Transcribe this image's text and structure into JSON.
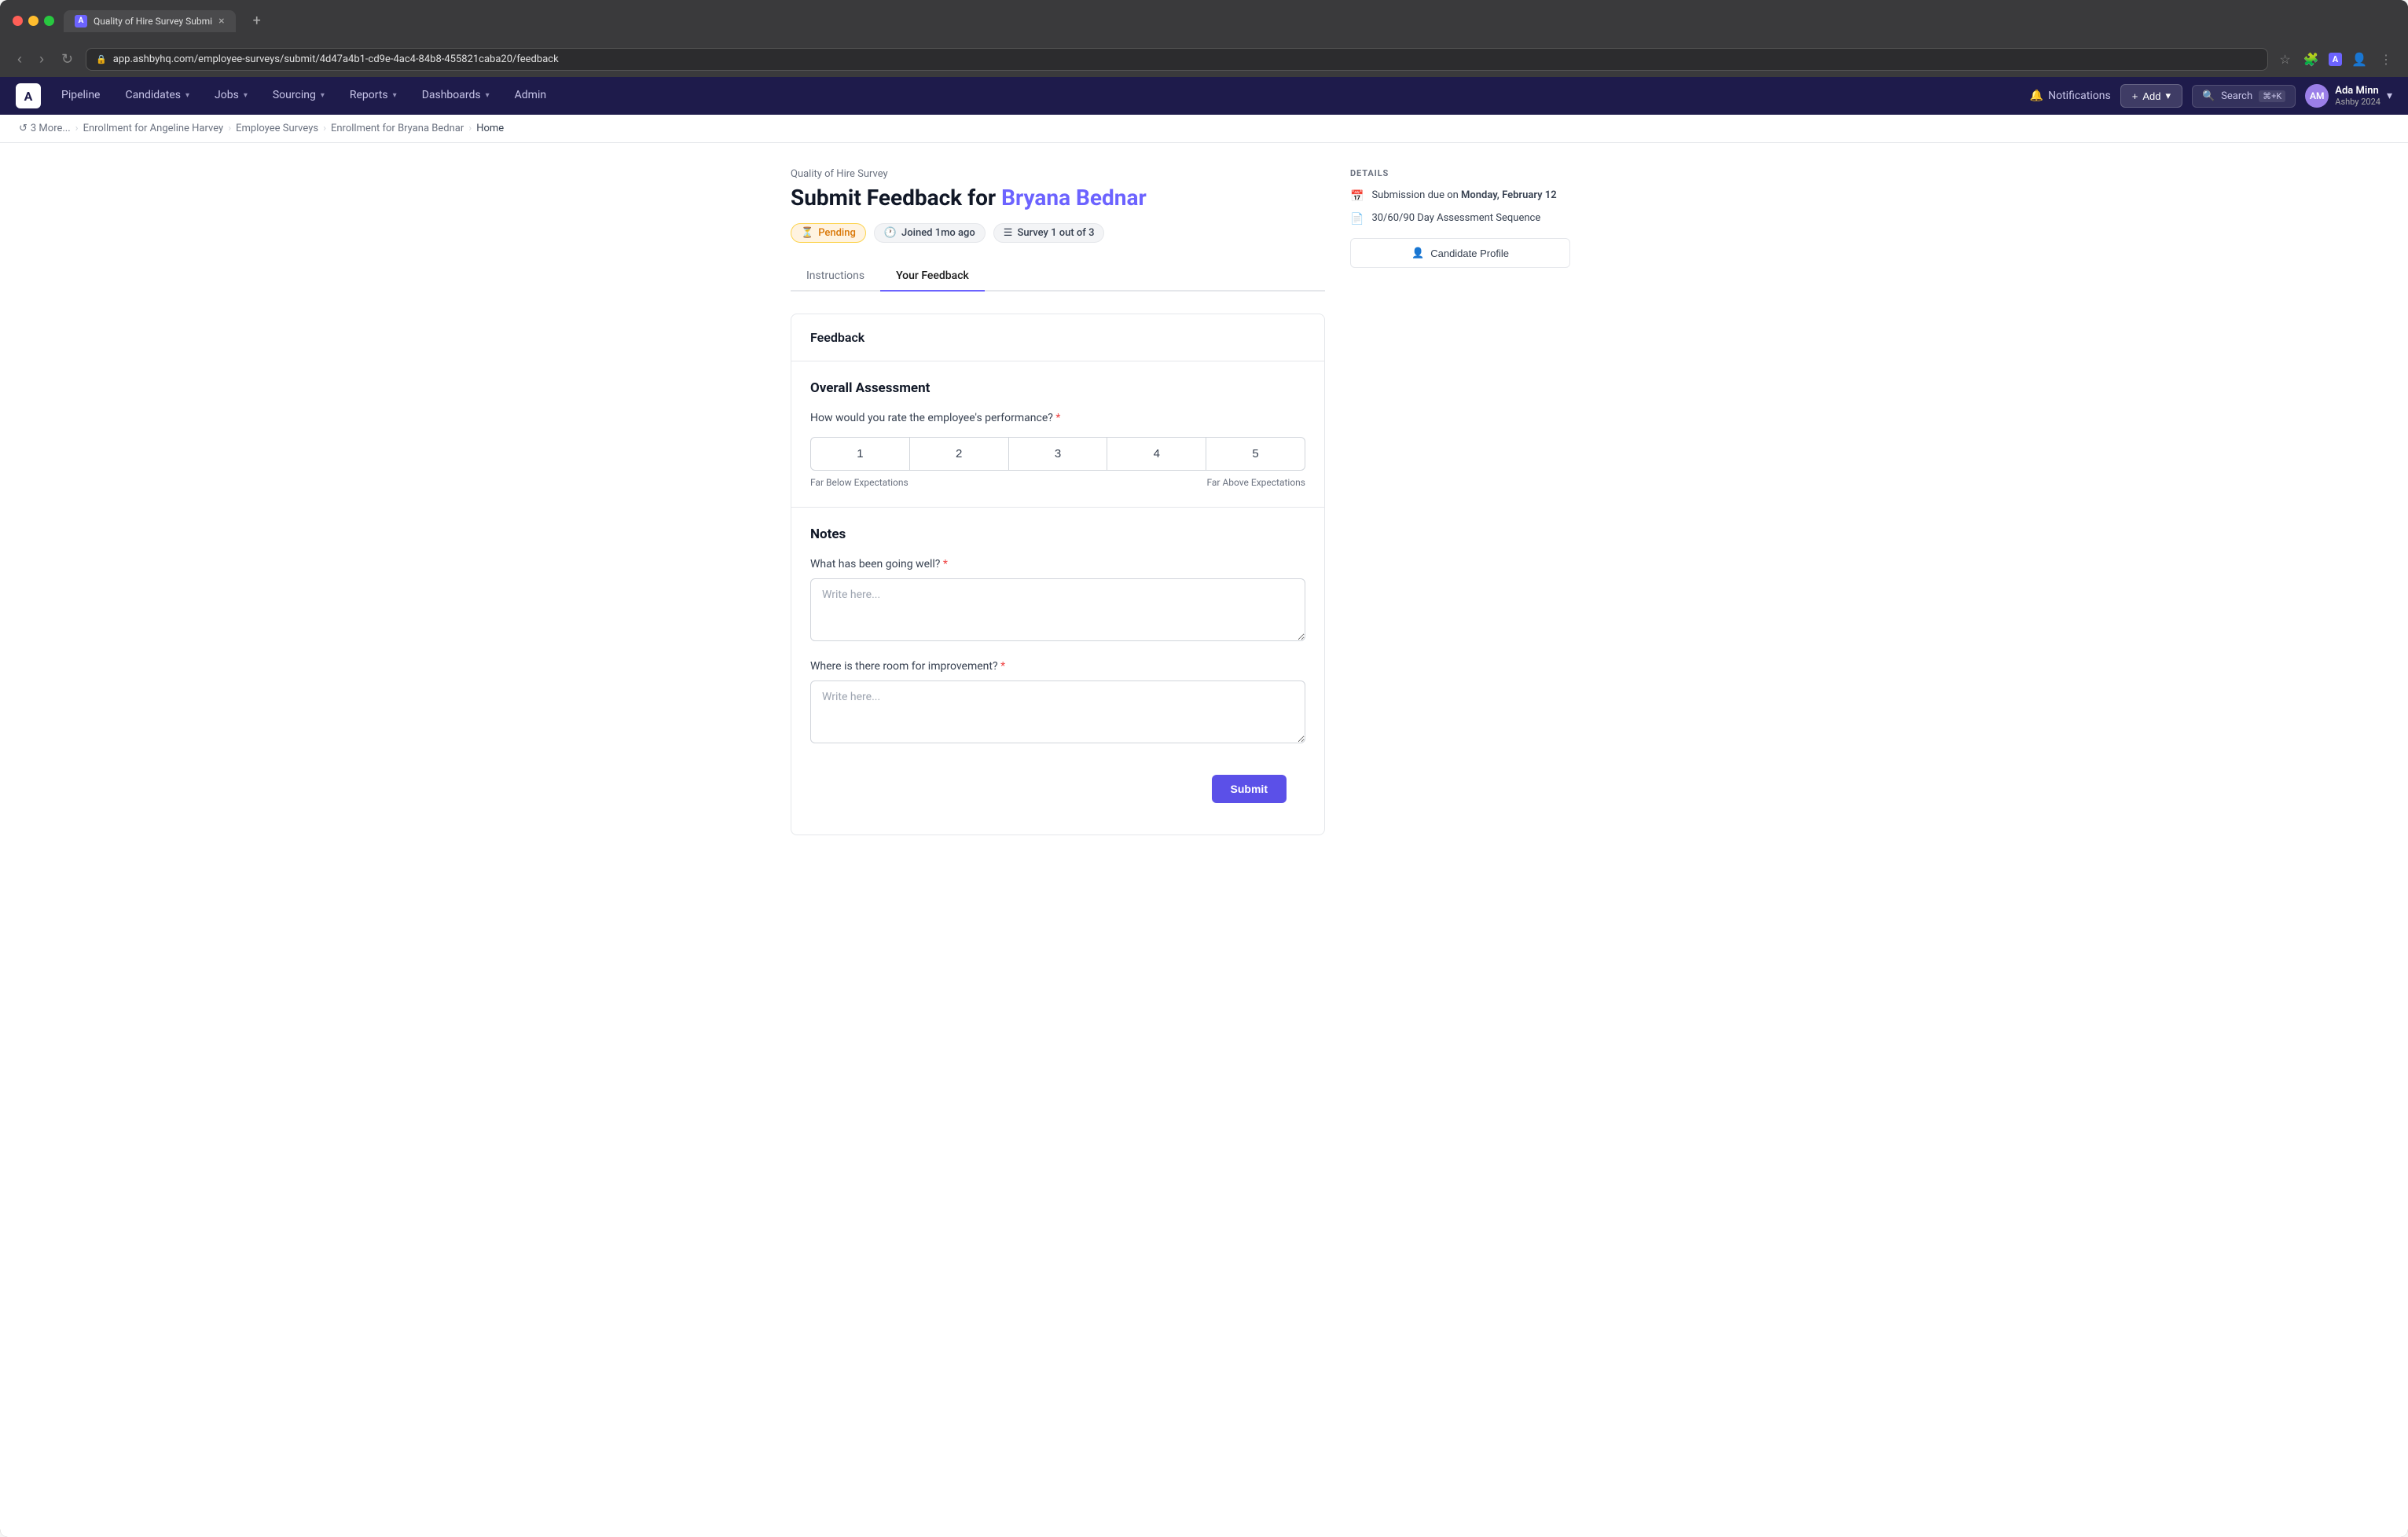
{
  "browser": {
    "tab_title": "Quality of Hire Survey Submi",
    "tab_favicon": "A",
    "url": "app.ashbyhq.com/employee-surveys/submit/4d47a4b1-cd9e-4ac4-84b8-455821caba20/feedback",
    "new_tab_icon": "+"
  },
  "nav": {
    "logo": "A",
    "items": [
      {
        "label": "Pipeline",
        "has_dropdown": false
      },
      {
        "label": "Candidates",
        "has_dropdown": true
      },
      {
        "label": "Jobs",
        "has_dropdown": true
      },
      {
        "label": "Sourcing",
        "has_dropdown": true
      },
      {
        "label": "Reports",
        "has_dropdown": true
      },
      {
        "label": "Dashboards",
        "has_dropdown": true
      },
      {
        "label": "Admin",
        "has_dropdown": false
      }
    ],
    "notifications_label": "Notifications",
    "add_label": "Add",
    "search_label": "Search",
    "search_kbd": "⌘+K",
    "user_name": "Ada Minn",
    "user_org": "Ashby 2024",
    "user_initials": "AM"
  },
  "breadcrumb": {
    "items": [
      {
        "label": "3 More...",
        "active": false
      },
      {
        "label": "Enrollment for Angeline Harvey",
        "active": false
      },
      {
        "label": "Employee Surveys",
        "active": false
      },
      {
        "label": "Enrollment for Bryana Bednar",
        "active": false
      },
      {
        "label": "Home",
        "active": true
      }
    ]
  },
  "page": {
    "survey_label": "Quality of Hire Survey",
    "title_prefix": "Submit Feedback for",
    "candidate_name": "Bryana Bednar",
    "status": {
      "pending_label": "Pending",
      "joined_label": "Joined 1mo ago",
      "survey_label": "Survey 1 out of 3"
    },
    "tabs": [
      {
        "label": "Instructions",
        "active": false
      },
      {
        "label": "Your Feedback",
        "active": true
      }
    ],
    "feedback_section": {
      "header": "Feedback",
      "overall_assessment": {
        "title": "Overall Assessment",
        "question": "How would you rate the employee's performance?",
        "required": true,
        "rating_options": [
          "1",
          "2",
          "3",
          "4",
          "5"
        ],
        "label_low": "Far Below Expectations",
        "label_high": "Far Above Expectations"
      },
      "notes": {
        "title": "Notes",
        "question1": "What has been going well?",
        "question1_required": true,
        "placeholder1": "Write here...",
        "question2": "Where is there room for improvement?",
        "question2_required": true,
        "placeholder2": "Write here..."
      },
      "submit_label": "Submit"
    },
    "details": {
      "section_label": "DETAILS",
      "submission_label": "Submission due on",
      "submission_date": "Monday, February 12",
      "assessment_label": "30/60/90 Day Assessment Sequence",
      "candidate_profile_label": "Candidate Profile"
    }
  }
}
